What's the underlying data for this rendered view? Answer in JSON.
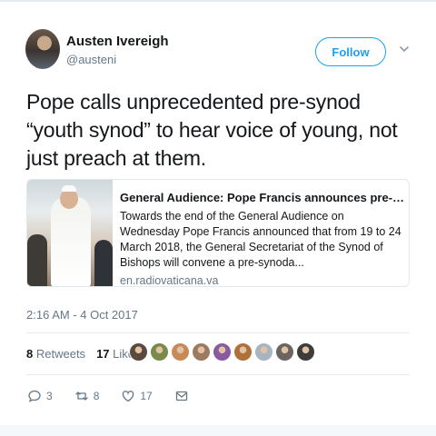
{
  "author": {
    "name": "Austen Ivereigh",
    "handle": "@austeni"
  },
  "follow_label": "Follow",
  "tweet_text": "Pope calls unprecedented pre-synod “youth synod” to hear voice of young, not just preach at them.",
  "card": {
    "title": "General Audience: Pope Francis announces pre-synodal...",
    "description": "Towards the end of the General Audience on Wednesday Pope Francis announced that from 19 to 24 March 2018, the General Secretariat of the Synod of Bishops will convene a pre-synoda...",
    "url": "en.radiovaticana.va"
  },
  "timestamp": "2:16 AM - 4 Oct 2017",
  "stats": {
    "retweets_count": "8",
    "retweets_label": "Retweets",
    "likes_count": "17",
    "likes_label": "Likes"
  },
  "liker_avatar_colors": [
    "#5a4a3e",
    "#7a8a4a",
    "#c98a5a",
    "#9c7a62",
    "#8a5aa0",
    "#b0703a",
    "#a8b4c0",
    "#6a6560",
    "#3c3c3c"
  ],
  "actions": {
    "reply_count": "3",
    "retweet_count": "8",
    "like_count": "17"
  },
  "icons": {
    "more": "chevron-down-icon",
    "reply": "reply-icon",
    "retweet": "retweet-icon",
    "like": "heart-icon",
    "message": "message-icon"
  },
  "colors": {
    "accent": "#1da1f2",
    "muted": "#657786",
    "text": "#14171a"
  }
}
